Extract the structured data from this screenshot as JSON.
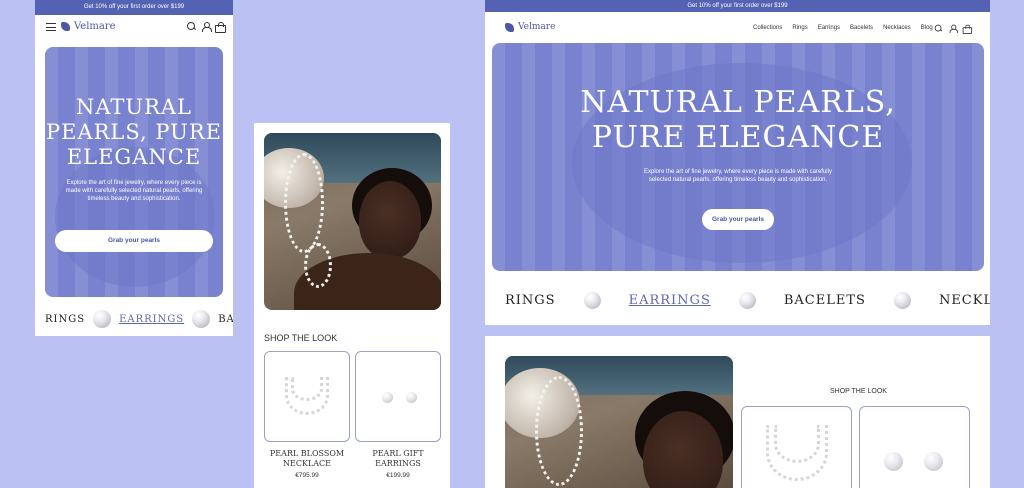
{
  "promo": "Get 10% off your first order over $199",
  "brand": "Velmare",
  "nav": [
    "Collections",
    "Rings",
    "Earrings",
    "Bacelets",
    "Necklaces",
    "Blog"
  ],
  "hero": {
    "title_mobile": [
      "NATURAL",
      "PEARLS, PURE",
      "ELEGANCE"
    ],
    "title_desktop": [
      "NATURAL PEARLS,",
      "PURE ELEGANCE"
    ],
    "subtitle": "Explore the art of fine jewelry, where every piece is made with carefully selected natural pearls, offering timeless beauty and sophistication.",
    "cta": "Grab your pearls"
  },
  "categories": [
    "RINGS",
    "EARRINGS",
    "BACELETS",
    "NECKLACES"
  ],
  "categories_mobile_visible": [
    "RINGS",
    "EARRINGS",
    "BACELE"
  ],
  "shop": {
    "title_mobile": "SHOP THE LOOK",
    "title_desktop": "SHOP THE LOOK",
    "products": [
      {
        "name": "PEARL BLOSSOM",
        "name2": "NECKLACE",
        "price": "€795.99"
      },
      {
        "name": "PEARL GIFT",
        "name2": "EARRINGS",
        "price": "€199.99"
      }
    ]
  },
  "colors": {
    "background": "#bcc1f3",
    "promo": "#5462b4",
    "hero": "#7882cf",
    "accent": "#5c66b8"
  }
}
